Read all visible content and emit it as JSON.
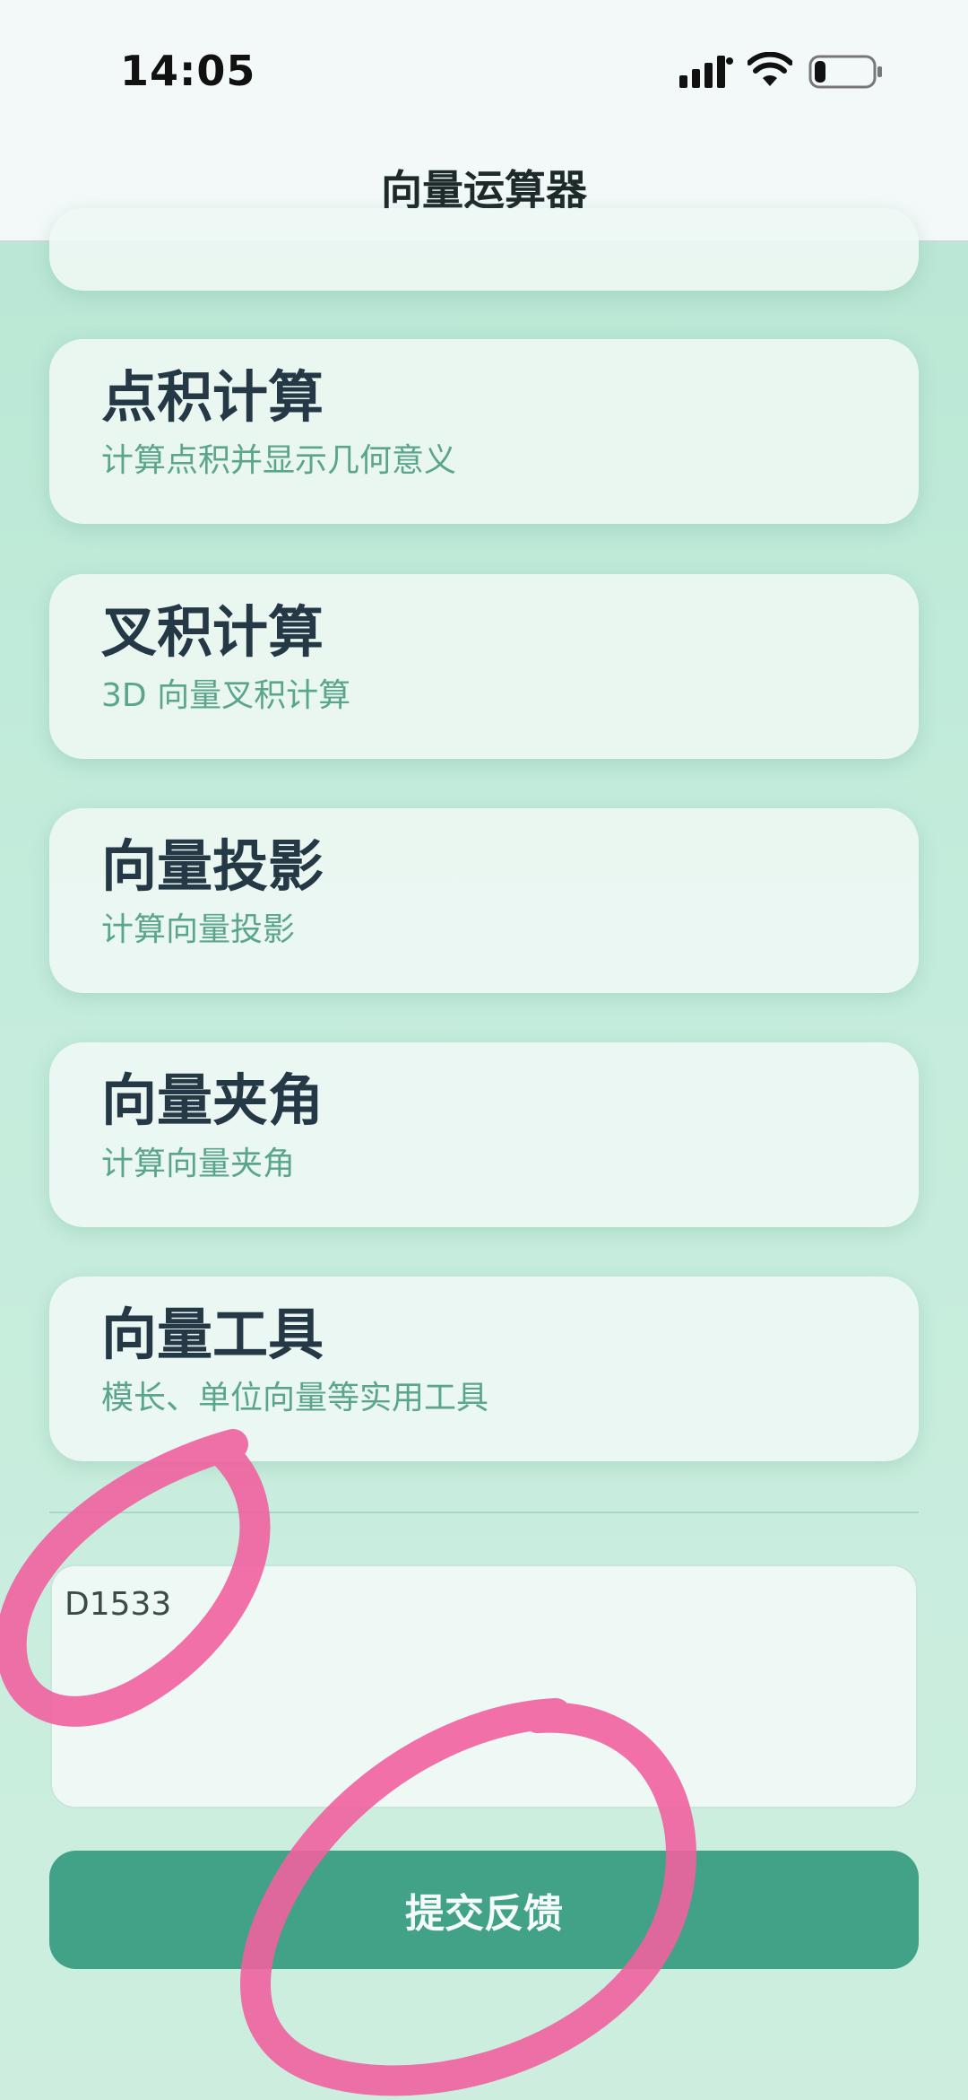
{
  "status_bar": {
    "time": "14:05",
    "icons": [
      "signal-icon",
      "wifi-icon",
      "battery-icon"
    ],
    "battery_level": 0.2
  },
  "header": {
    "title": "向量运算器"
  },
  "menu": {
    "items": [
      {
        "title": "点积计算",
        "subtitle": "计算点积并显示几何意义"
      },
      {
        "title": "叉积计算",
        "subtitle": "3D 向量叉积计算"
      },
      {
        "title": "向量投影",
        "subtitle": "计算向量投影"
      },
      {
        "title": "向量夹角",
        "subtitle": "计算向量夹角"
      },
      {
        "title": "向量工具",
        "subtitle": "模长、单位向量等实用工具"
      }
    ]
  },
  "feedback": {
    "value": "D1533",
    "submit_label": "提交反馈"
  },
  "colors": {
    "accent": "#41a288",
    "subtitle": "#5aa58c",
    "annotation": "#f0609e"
  }
}
